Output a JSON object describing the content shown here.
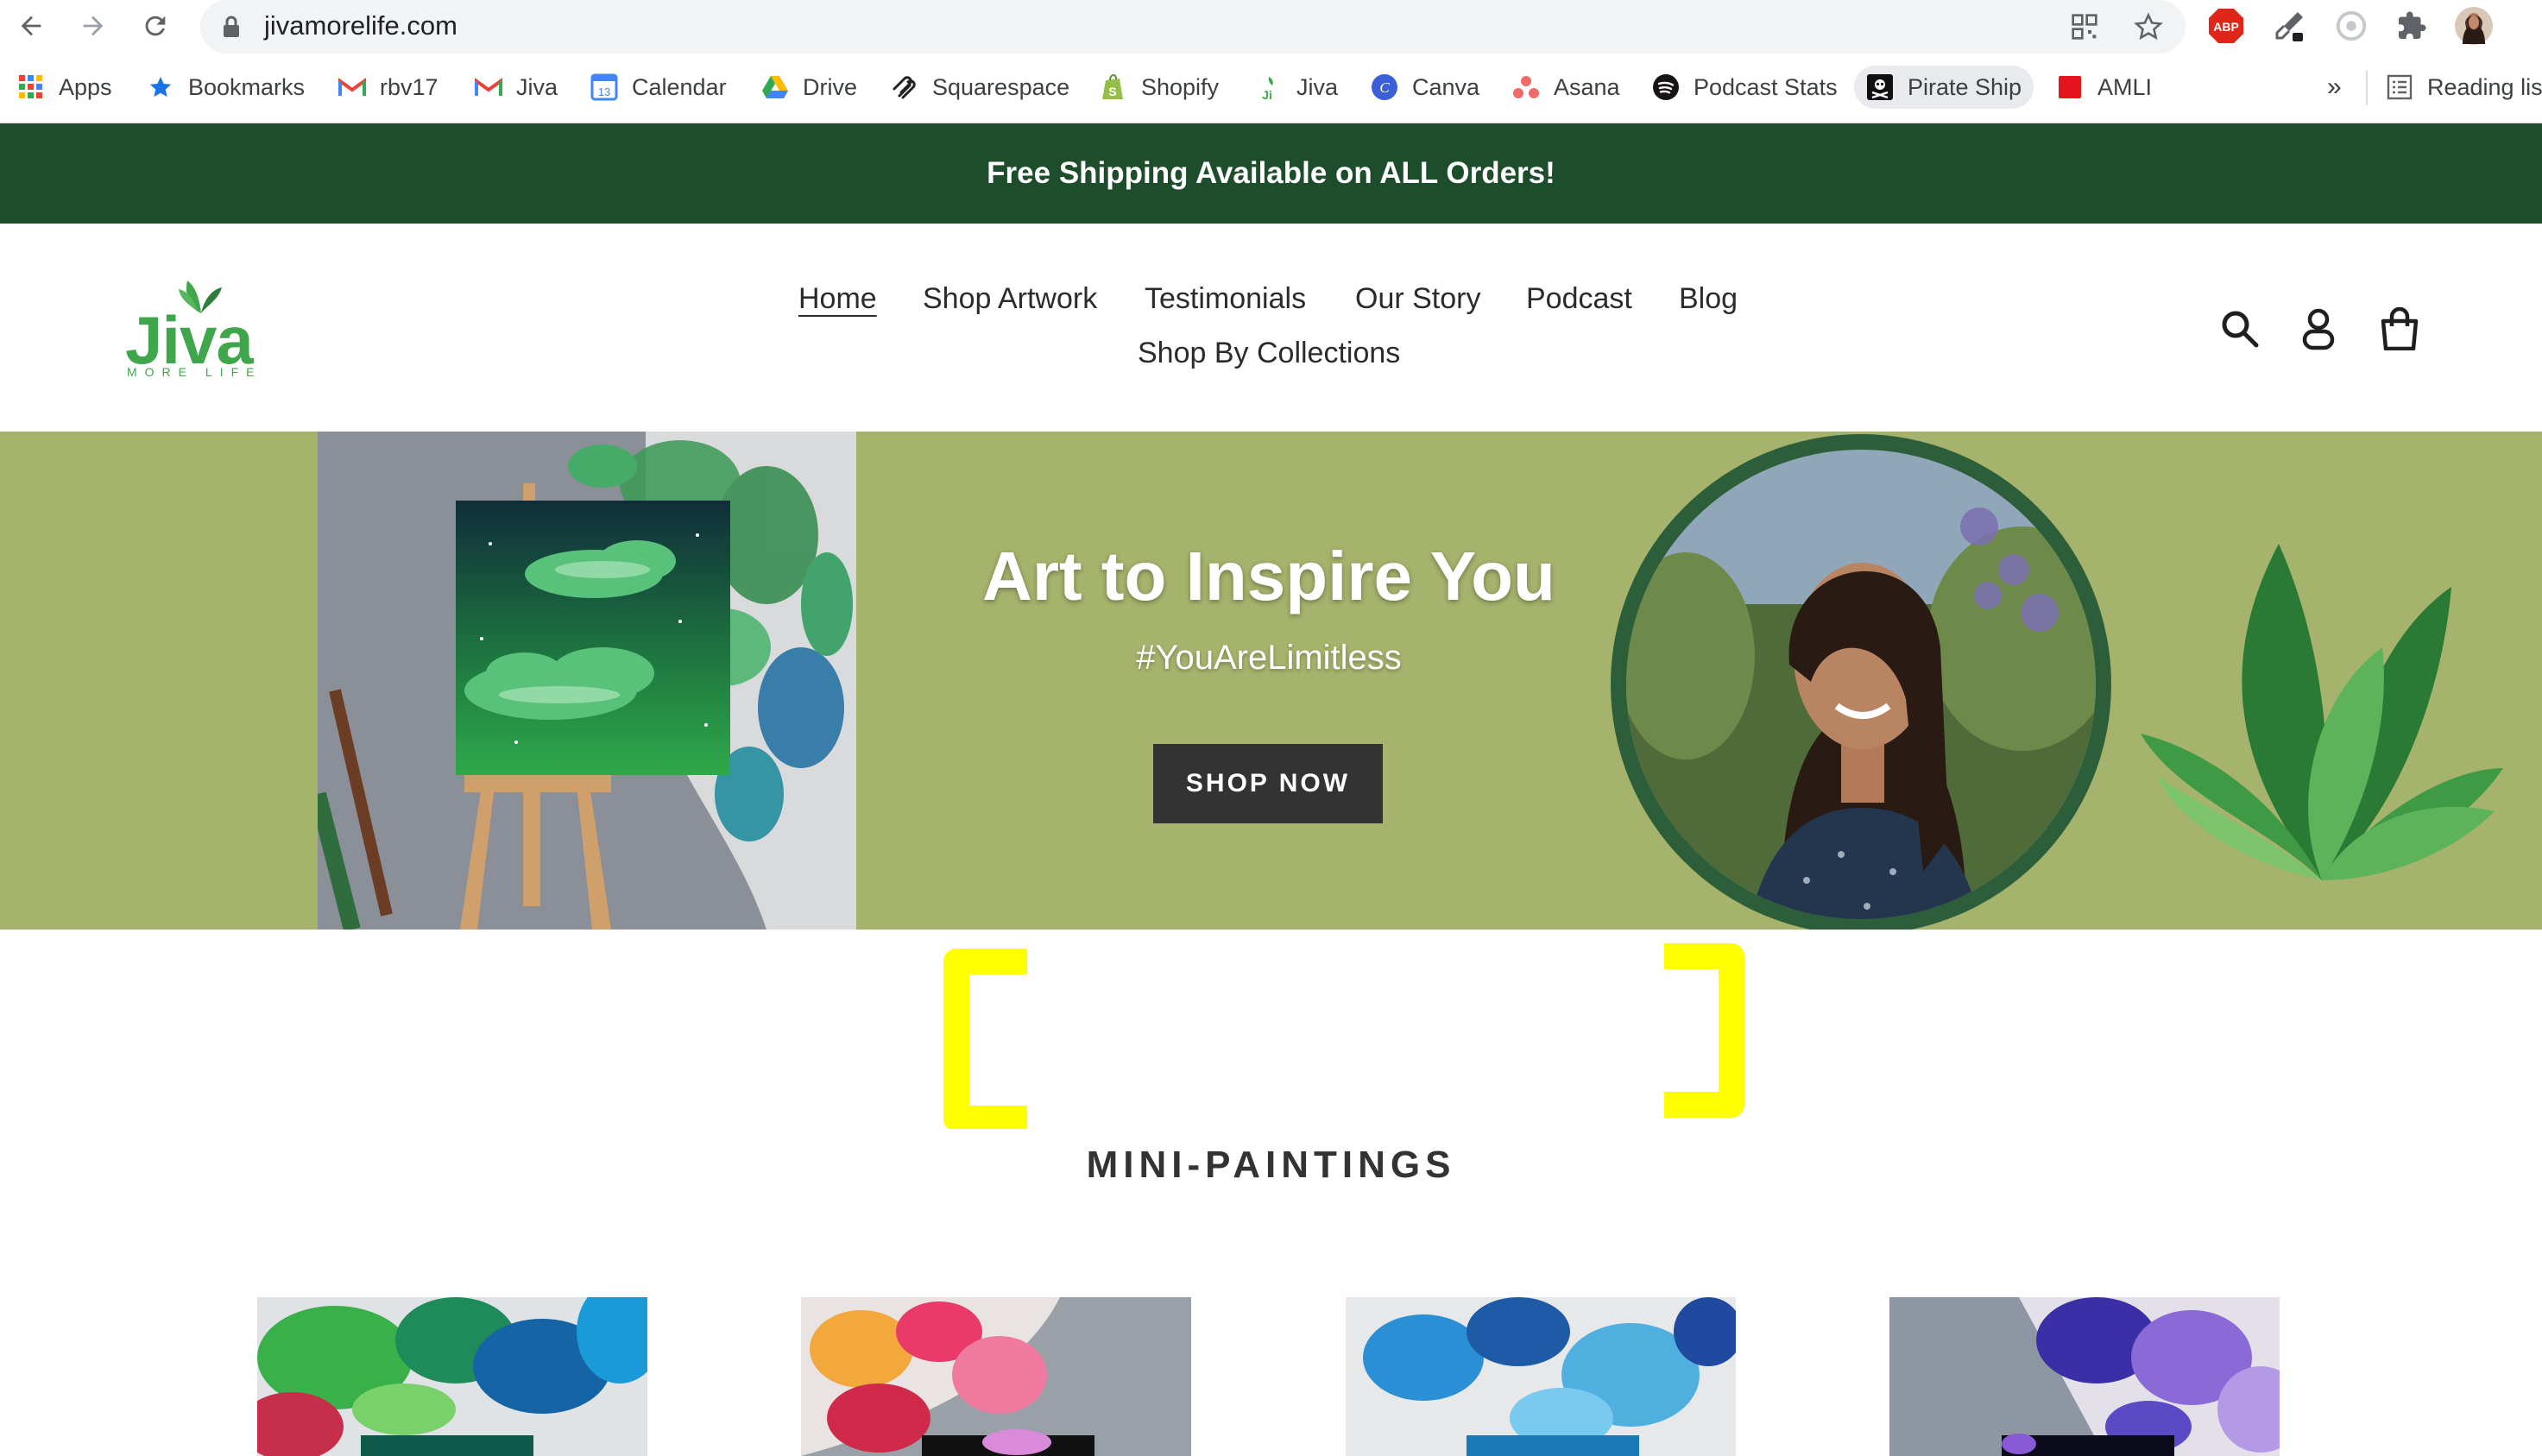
{
  "browser": {
    "url": "jivamorelife.com",
    "nav": {
      "back": "back-arrow-icon",
      "forward": "forward-arrow-icon",
      "reload": "reload-icon"
    },
    "extension_badge": "ABP",
    "bookmarks": [
      {
        "label": "Apps",
        "icon": "apps-grid-icon"
      },
      {
        "label": "Bookmarks",
        "icon": "star-icon"
      },
      {
        "label": "rbv17",
        "icon": "gmail-icon"
      },
      {
        "label": "Jiva",
        "icon": "gmail-icon"
      },
      {
        "label": "Calendar",
        "icon": "calendar-icon"
      },
      {
        "label": "Drive",
        "icon": "drive-icon"
      },
      {
        "label": "Squarespace",
        "icon": "squarespace-icon"
      },
      {
        "label": "Shopify",
        "icon": "shopify-icon"
      },
      {
        "label": "Jiva",
        "icon": "jiva-icon"
      },
      {
        "label": "Canva",
        "icon": "canva-icon"
      },
      {
        "label": "Asana",
        "icon": "asana-icon"
      },
      {
        "label": "Podcast Stats",
        "icon": "spotify-icon"
      },
      {
        "label": "Pirate Ship",
        "icon": "pirate-ship-icon"
      },
      {
        "label": "AMLI",
        "icon": "amli-icon"
      }
    ],
    "overflow": "»",
    "reading_list": "Reading lis"
  },
  "announcement": "Free Shipping Available on ALL Orders!",
  "header": {
    "logo_text": "Jiva",
    "logo_tagline": "MORE LIFE",
    "menu": [
      "Home",
      "Shop Artwork",
      "Testimonials",
      "Our Story",
      "Podcast",
      "Blog",
      "Shop By Collections"
    ],
    "active": "Home"
  },
  "hero": {
    "title": "Art to Inspire You",
    "subtitle": "#YouAreLimitless",
    "button": "SHOP NOW"
  },
  "section": {
    "title": "MINI-PAINTINGS"
  },
  "colors": {
    "announcement_bg": "#1e4d2b",
    "hero_bg": "#a5b36c",
    "logo_green": "#3fa64c",
    "button_bg": "#333333",
    "marker_yellow": "#ffff00"
  }
}
